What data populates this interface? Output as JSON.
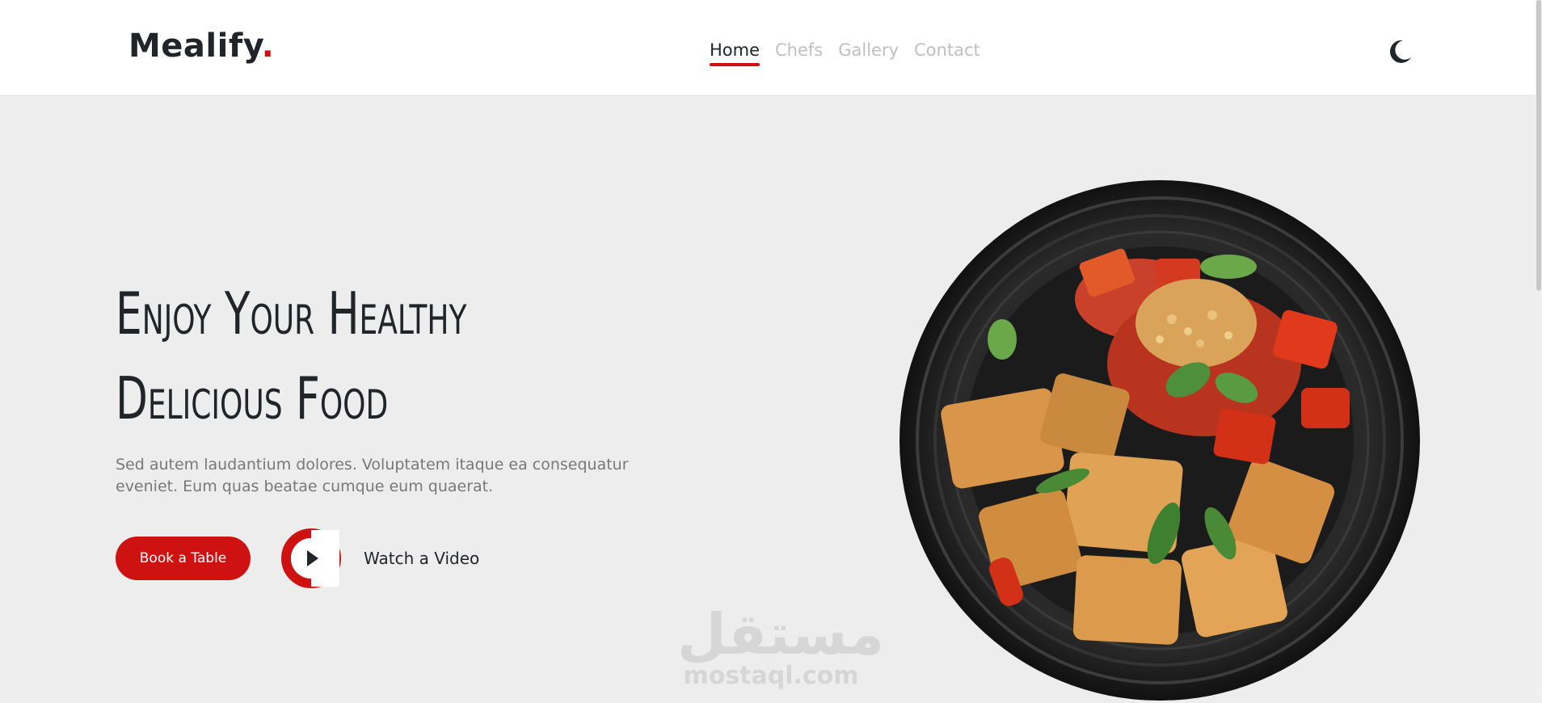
{
  "header": {
    "logo": {
      "text": "Mealify",
      "dot": "."
    },
    "nav": [
      {
        "label": "Home",
        "active": true
      },
      {
        "label": "Chefs",
        "active": false
      },
      {
        "label": "Gallery",
        "active": false
      },
      {
        "label": "Contact",
        "active": false
      }
    ],
    "theme_toggle_icon": "moon-icon"
  },
  "hero": {
    "title_line1": "Enjoy Your Healthy",
    "title_line2": "Delicious Food",
    "description": "Sed autem laudantium dolores. Voluptatem itaque ea consequatur eveniet. Eum quas beatae cumque eum quaerat.",
    "book_button": "Book a Table",
    "video_link": "Watch a Video",
    "video_icon": "play-icon",
    "image": "food-plate-image"
  },
  "watermark": {
    "arabic": "مستقل",
    "latin": "mostaql.com"
  },
  "colors": {
    "accent": "#ce1212",
    "text": "#212529",
    "muted": "#787878",
    "nav_inactive": "#c0c0c0",
    "hero_bg": "#ededed"
  }
}
